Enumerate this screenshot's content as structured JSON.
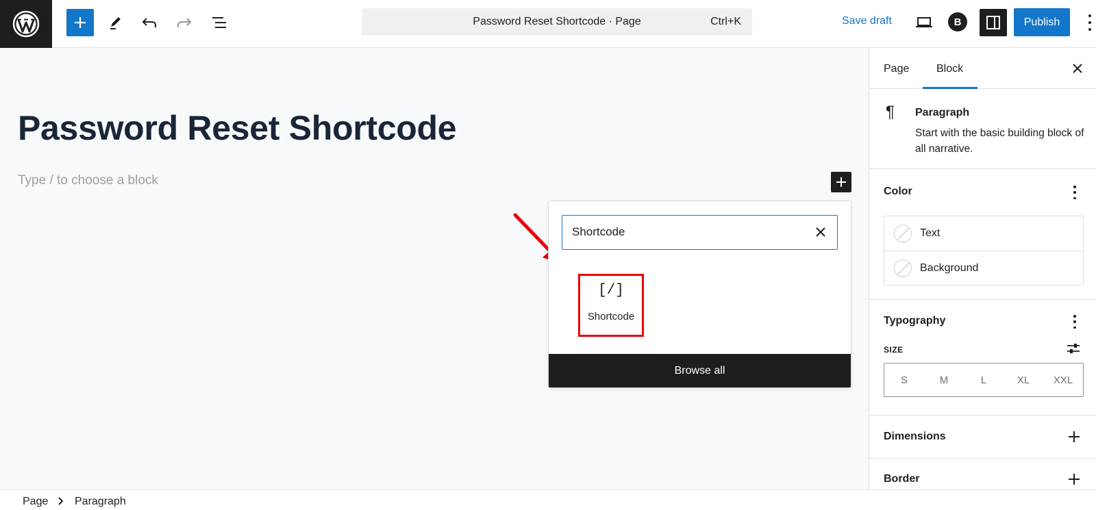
{
  "topbar": {
    "document_title": "Password Reset Shortcode · Page",
    "shortcut": "Ctrl+K",
    "save_draft": "Save draft",
    "publish": "Publish",
    "plugin_badge": "B",
    "accent_color": "#1276c9"
  },
  "editor": {
    "post_title": "Password Reset Shortcode",
    "block_placeholder": "Type / to choose a block"
  },
  "inserter": {
    "search_value": "Shortcode",
    "results": [
      {
        "icon_text": "[/]",
        "label": "Shortcode"
      }
    ],
    "browse_all": "Browse all",
    "highlight_color": "#e8000b"
  },
  "sidebar": {
    "tabs": [
      {
        "label": "Page",
        "active": false
      },
      {
        "label": "Block",
        "active": true
      }
    ],
    "block": {
      "icon": "pilcrow-icon",
      "name": "Paragraph",
      "description": "Start with the basic building block of all narrative."
    },
    "color": {
      "title": "Color",
      "items": [
        {
          "label": "Text"
        },
        {
          "label": "Background"
        }
      ]
    },
    "typography": {
      "title": "Typography",
      "size_label": "SIZE",
      "sizes": [
        "S",
        "M",
        "L",
        "XL",
        "XXL"
      ]
    },
    "dimensions": {
      "title": "Dimensions"
    },
    "border": {
      "title": "Border"
    }
  },
  "footer": {
    "breadcrumb": [
      "Page",
      "Paragraph"
    ]
  }
}
